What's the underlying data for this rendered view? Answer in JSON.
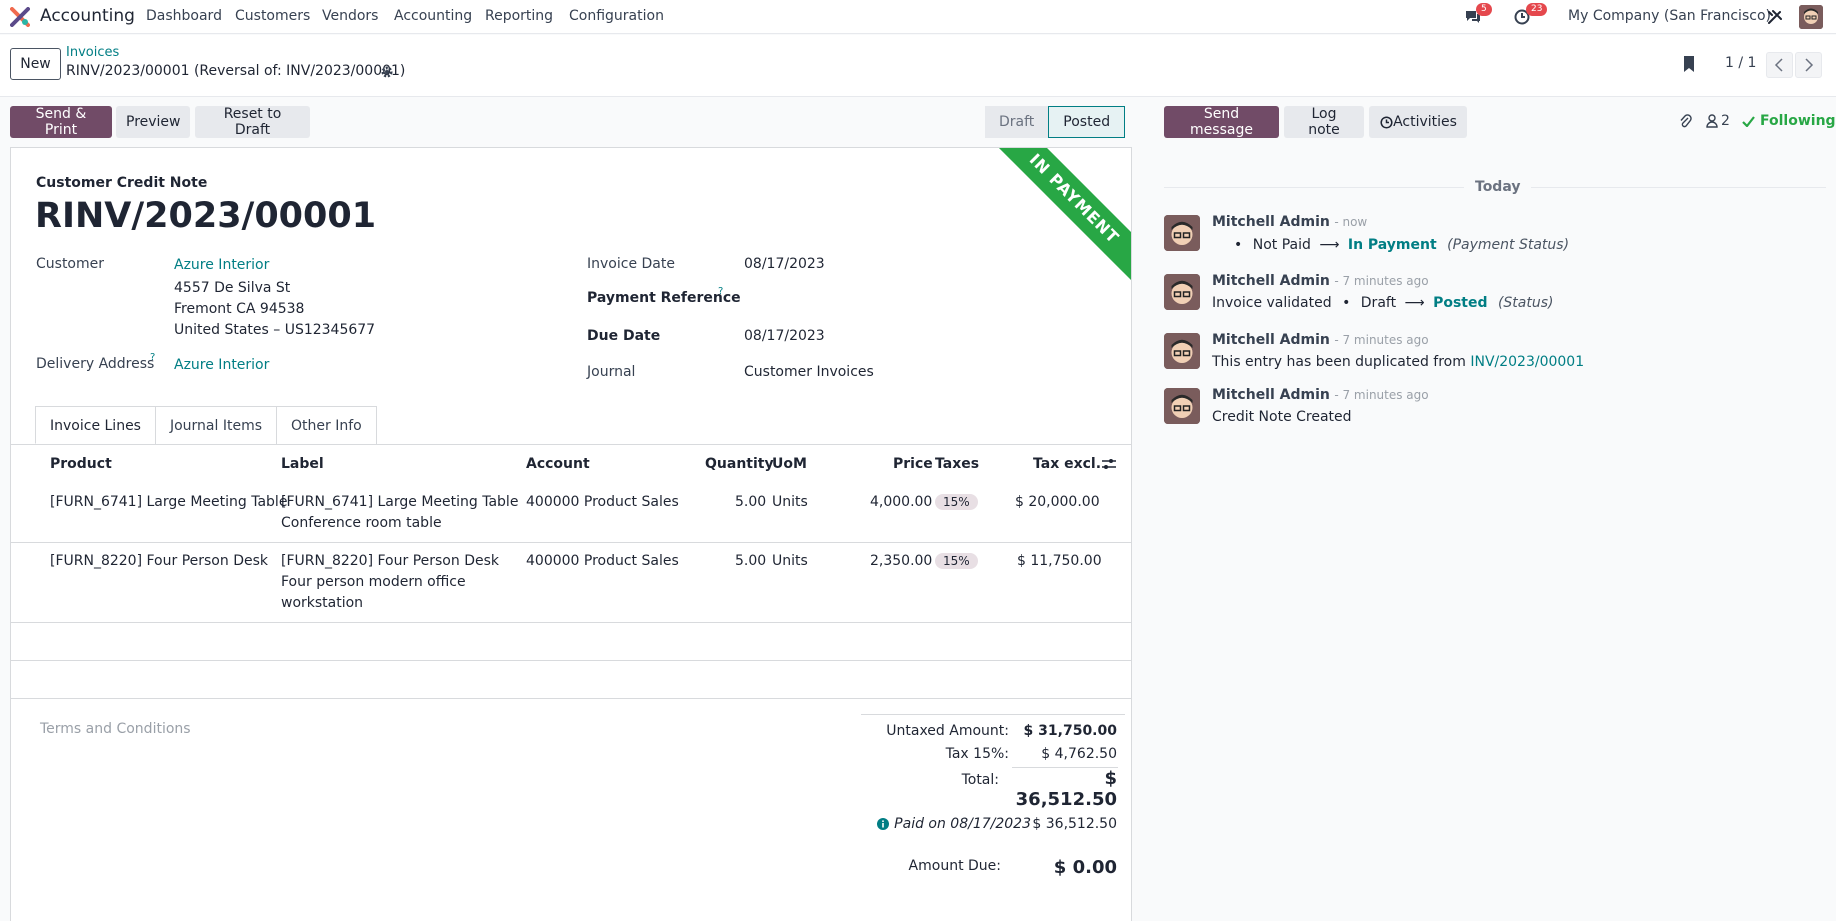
{
  "navbar": {
    "app_name": "Accounting",
    "menu": [
      "Dashboard",
      "Customers",
      "Vendors",
      "Accounting",
      "Reporting",
      "Configuration"
    ],
    "messages_count": "5",
    "activities_count": "23",
    "company": "My Company (San Francisco)"
  },
  "control": {
    "new_label": "New",
    "breadcrumb_parent": "Invoices",
    "breadcrumb_current": "RINV/2023/00001 (Reversal of: INV/2023/00001)",
    "pager": "1 / 1"
  },
  "actions": {
    "send_print": "Send & Print",
    "preview": "Preview",
    "reset_draft": "Reset to Draft"
  },
  "status": {
    "steps": [
      "Draft",
      "Posted"
    ],
    "current": "Posted"
  },
  "form": {
    "ribbon": "IN PAYMENT",
    "doc_type": "Customer Credit Note",
    "number": "RINV/2023/00001",
    "customer_label": "Customer",
    "customer_name": "Azure Interior",
    "address": [
      "4557 De Silva St",
      "Fremont CA 94538",
      "United States – US12345677"
    ],
    "delivery_label": "Delivery Address",
    "delivery_help": "?",
    "delivery_name": "Azure Interior",
    "invoice_date_label": "Invoice Date",
    "invoice_date": "08/17/2023",
    "payment_ref_label": "Payment Reference",
    "payment_ref_help": "?",
    "due_date_label": "Due Date",
    "due_date": "08/17/2023",
    "journal_label": "Journal",
    "journal": "Customer Invoices"
  },
  "tabs": [
    "Invoice Lines",
    "Journal Items",
    "Other Info"
  ],
  "lines": {
    "headers": [
      "Product",
      "Label",
      "Account",
      "Quantity",
      "UoM",
      "Price",
      "Taxes",
      "Tax excl."
    ],
    "rows": [
      {
        "product": "[FURN_6741] Large Meeting Table",
        "label1": "[FURN_6741] Large Meeting Table",
        "label2": "Conference room table",
        "label3": "",
        "account": "400000 Product Sales",
        "quantity": "5.00",
        "uom": "Units",
        "price": "4,000.00",
        "tax": "15%",
        "subtotal": "$ 20,000.00"
      },
      {
        "product": "[FURN_8220] Four Person Desk",
        "label1": "[FURN_8220] Four Person Desk",
        "label2": "Four person modern office",
        "label3": "workstation",
        "account": "400000 Product Sales",
        "quantity": "5.00",
        "uom": "Units",
        "price": "2,350.00",
        "tax": "15%",
        "subtotal": "$ 11,750.00"
      }
    ]
  },
  "terms_placeholder": "Terms and Conditions",
  "totals": {
    "untaxed_label": "Untaxed Amount:",
    "untaxed": "$ 31,750.00",
    "tax_label": "Tax 15%:",
    "tax": "$ 4,762.50",
    "total_label": "Total:",
    "total": "$ 36,512.50",
    "paid_label": "Paid on 08/17/2023",
    "paid": "$ 36,512.50",
    "due_label": "Amount Due:",
    "due": "$ 0.00"
  },
  "chatter": {
    "send_message": "Send message",
    "log_note": "Log note",
    "activities": "Activities",
    "followers_count": "2",
    "following": "Following",
    "day": "Today",
    "messages": [
      {
        "author": "Mitchell Admin",
        "time": "- now",
        "type": "tracking",
        "bullet": "Not Paid",
        "new_value": "In Payment",
        "field": "(Payment Status)"
      },
      {
        "author": "Mitchell Admin",
        "time": "- 7 minutes ago",
        "type": "tracking",
        "prefix": "Invoice validated",
        "bullet": "Draft",
        "new_value": "Posted",
        "field": "(Status)"
      },
      {
        "author": "Mitchell Admin",
        "time": "- 7 minutes ago",
        "type": "text",
        "body": "This entry has been duplicated from",
        "link": "INV/2023/00001"
      },
      {
        "author": "Mitchell Admin",
        "time": "- 7 minutes ago",
        "type": "text",
        "body": "Credit Note Created"
      }
    ]
  },
  "colors": {
    "brand": "#714b67",
    "link": "#017e84",
    "ribbon": "#28a745",
    "badge": "#e5484d"
  }
}
